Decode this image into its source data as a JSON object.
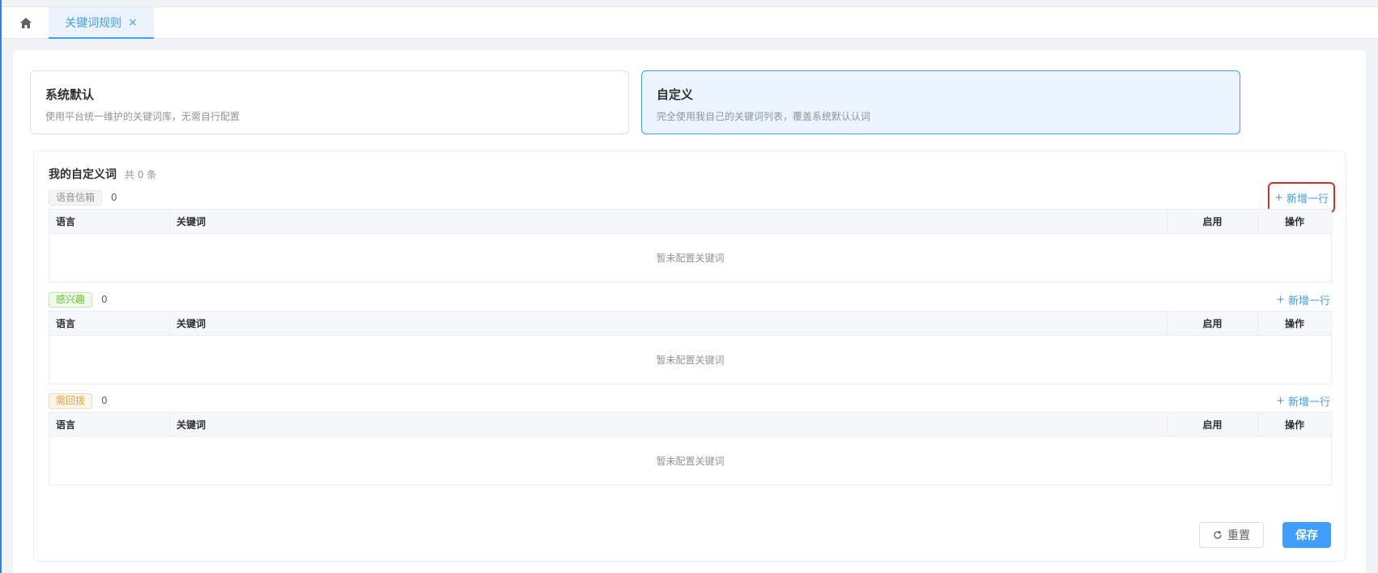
{
  "tabs": {
    "home_icon": "home-icon",
    "active_label": "关键词规则",
    "close_glyph": "×"
  },
  "modes": [
    {
      "title": "系统默认",
      "desc": "使用平台统一维护的关键词库，无需自行配置",
      "selected": false
    },
    {
      "title": "自定义",
      "desc": "完全使用我自己的关键词列表，覆盖系统默认认词",
      "selected": true
    }
  ],
  "panel": {
    "title": "我的自定义词",
    "count": "共 0 条"
  },
  "groups": [
    {
      "tag": "语音信箱",
      "count": "0",
      "add_label": "新增一行"
    },
    {
      "tag": "感兴趣",
      "count": "0",
      "add_label": "新增一行"
    },
    {
      "tag": "需回拨",
      "count": "0",
      "add_label": "新增一行"
    }
  ],
  "table": {
    "col_language": "语言",
    "col_keyword": "关键词",
    "col_enable": "启用",
    "col_ops": "操作",
    "empty_text": "暂未配置关键词"
  },
  "actions": {
    "reset_label": "重置",
    "save_label": "保存"
  },
  "colors": {
    "primary": "#409eff",
    "highlight_box": "#d93025"
  }
}
